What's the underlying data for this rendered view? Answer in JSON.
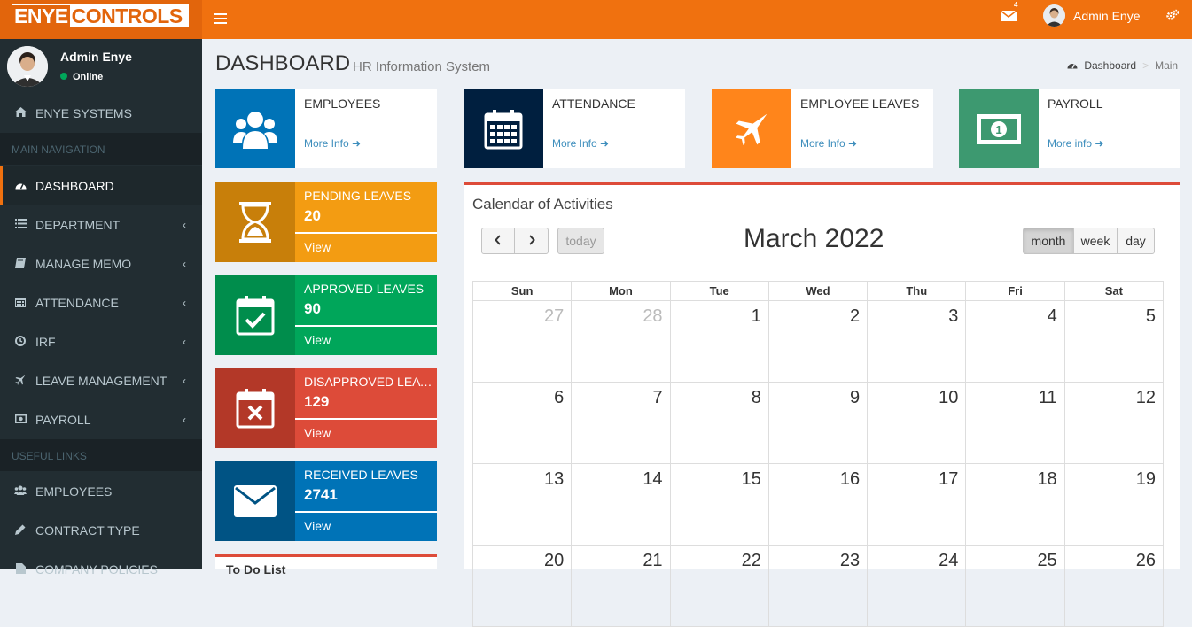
{
  "header": {
    "logo_part1": "ENYE",
    "logo_part2": "CONTROLS",
    "mail_badge": "4",
    "user_name": "Admin Enye"
  },
  "sidebar": {
    "user_name": "Admin Enye",
    "status": "Online",
    "brand_item": "ENYE SYSTEMS",
    "main_nav_header": "MAIN NAVIGATION",
    "items": [
      {
        "label": "DASHBOARD",
        "icon": "dashboard-icon"
      },
      {
        "label": "DEPARTMENT",
        "icon": "list-icon"
      },
      {
        "label": "MANAGE MEMO",
        "icon": "book-icon"
      },
      {
        "label": "ATTENDANCE",
        "icon": "calendar-icon"
      },
      {
        "label": "IRF",
        "icon": "clock-icon"
      },
      {
        "label": "LEAVE MANAGEMENT",
        "icon": "plane-icon"
      },
      {
        "label": "PAYROLL",
        "icon": "money-icon"
      }
    ],
    "useful_header": "USEFUL LINKS",
    "links": [
      {
        "label": "EMPLOYEES",
        "icon": "users-icon"
      },
      {
        "label": "CONTRACT TYPE",
        "icon": "tag-icon"
      },
      {
        "label": "COMPANY POLICIES",
        "icon": "file-icon"
      }
    ]
  },
  "page": {
    "title": "DASHBOARD",
    "subtitle": "HR Information System",
    "breadcrumb_home": "Dashboard",
    "breadcrumb_current": "Main"
  },
  "info_boxes": [
    {
      "title": "EMPLOYEES",
      "link": "More Info",
      "color": "#0073b7"
    },
    {
      "title": "ATTENDANCE",
      "link": "More Info",
      "color": "#001f3f"
    },
    {
      "title": "EMPLOYEE LEAVES",
      "link": "More Info",
      "color": "#ff851b"
    },
    {
      "title": "PAYROLL",
      "link": "More info",
      "color": "#3d9970"
    }
  ],
  "leave_boxes": [
    {
      "label": "PENDING LEAVES",
      "count": "20",
      "view": "View",
      "color": "#f39c12",
      "dark": "#c87f0a"
    },
    {
      "label": "APPROVED LEAVES",
      "count": "90",
      "view": "View",
      "color": "#00a65a",
      "dark": "#008d4c"
    },
    {
      "label": "DISAPPROVED LEAVES",
      "count": "129",
      "view": "View",
      "color": "#dd4b39",
      "dark": "#b33828"
    },
    {
      "label": "RECEIVED LEAVES",
      "count": "2741",
      "view": "View",
      "color": "#0073b7",
      "dark": "#005384"
    }
  ],
  "bottom_box_title": "To Do List",
  "calendar": {
    "title": "Calendar of Activities",
    "today_label": "today",
    "month_title": "March 2022",
    "views": [
      "month",
      "week",
      "day"
    ],
    "days_of_week": [
      "Sun",
      "Mon",
      "Tue",
      "Wed",
      "Thu",
      "Fri",
      "Sat"
    ],
    "weeks": [
      [
        "27",
        "28",
        "1",
        "2",
        "3",
        "4",
        "5"
      ],
      [
        "6",
        "7",
        "8",
        "9",
        "10",
        "11",
        "12"
      ],
      [
        "13",
        "14",
        "15",
        "16",
        "17",
        "18",
        "19"
      ],
      [
        "20",
        "21",
        "22",
        "23",
        "24",
        "25",
        "26"
      ]
    ]
  }
}
